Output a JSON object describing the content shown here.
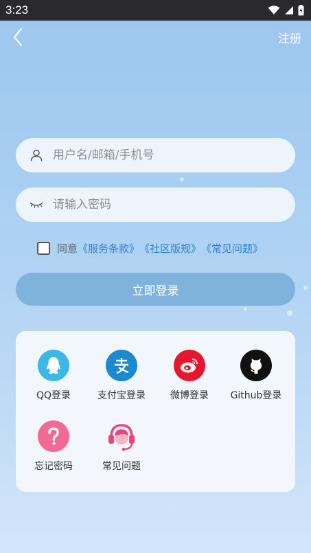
{
  "status_bar": {
    "time": "3:23",
    "battery_icon": "battery-charging-icon",
    "wifi_icon": "wifi-icon",
    "signal_icon": "signal-icon"
  },
  "top_bar": {
    "back_icon": "chevron-left-icon",
    "register_label": "注册"
  },
  "login_form": {
    "username": {
      "icon": "user-icon",
      "value": "",
      "placeholder": "用户名/邮箱/手机号"
    },
    "password": {
      "icon": "eye-closed-icon",
      "value": "",
      "placeholder": "请输入密码"
    },
    "agreement": {
      "checked": false,
      "prefix": "同意",
      "links": [
        "《服务条款》",
        "《社区版规》",
        "《常见问题》"
      ]
    },
    "submit_label": "立即登录"
  },
  "quick_login": [
    {
      "label": "QQ登录",
      "icon": "qq-icon",
      "color": "#3cb7e6"
    },
    {
      "label": "支付宝登录",
      "icon": "alipay-icon",
      "color": "#1d8ad0"
    },
    {
      "label": "微博登录",
      "icon": "weibo-icon",
      "color": "#e6162d"
    },
    {
      "label": "Github登录",
      "icon": "github-icon",
      "color": "#111111"
    }
  ],
  "help_items": [
    {
      "label": "忘记密码",
      "icon": "question-icon",
      "color": "#f06a93"
    },
    {
      "label": "常见问题",
      "icon": "customer-service-icon",
      "color": "#e8457a"
    }
  ],
  "colors": {
    "accent": "#2d7fd0",
    "button": "#7fb3db",
    "status_bar": "#2a2a2e"
  }
}
